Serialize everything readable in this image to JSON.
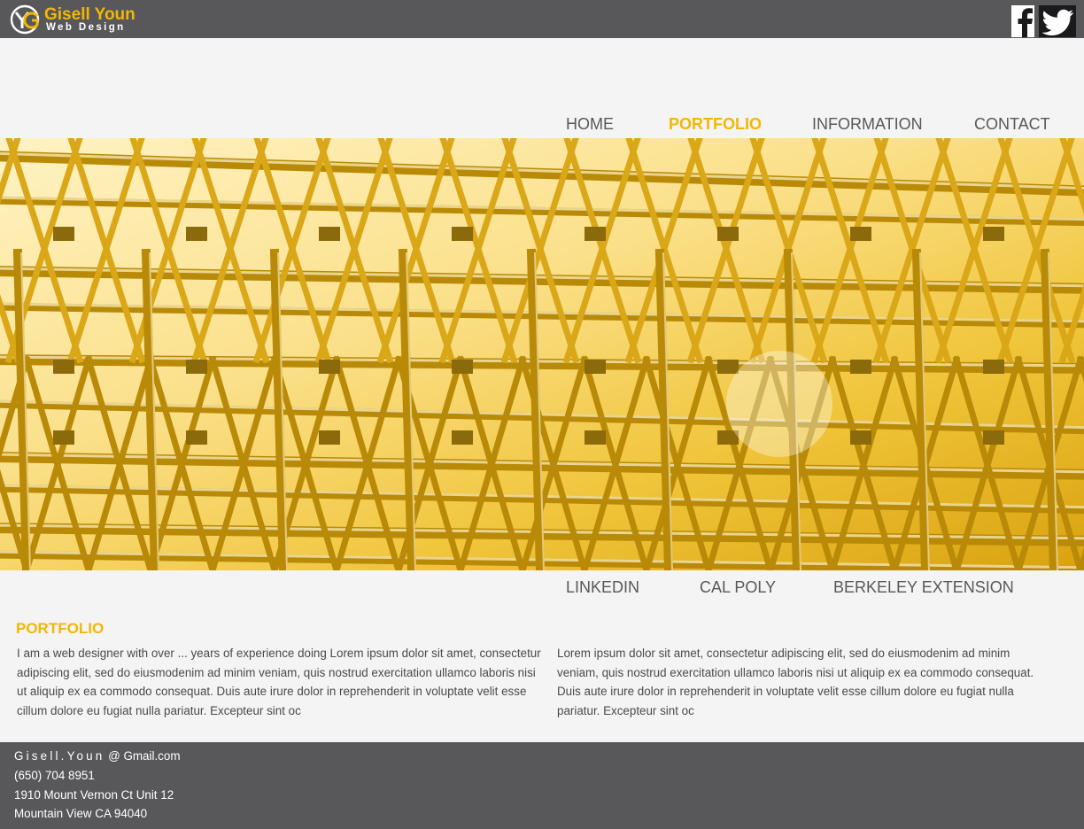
{
  "brand": {
    "name": "Gisell Youn",
    "tagline": "Web Design",
    "monogram": "YG",
    "accent_color": "#f2b705",
    "bar_color": "#58585a"
  },
  "social": {
    "facebook_icon": "facebook-icon",
    "twitter_icon": "twitter-icon"
  },
  "nav": {
    "items": [
      {
        "label": "HOME"
      },
      {
        "label": "PORTFOLIO"
      },
      {
        "label": "INFORMATION"
      },
      {
        "label": "CONTACT"
      }
    ],
    "active": "PORTFOLIO"
  },
  "hero": {
    "image": "golden steel roof trusses photo"
  },
  "subnav": {
    "items": [
      {
        "label": "LINKEDIN"
      },
      {
        "label": "CAL POLY"
      },
      {
        "label": "BERKELEY EXTENSION"
      }
    ]
  },
  "content": {
    "title": "PORTFOLIO",
    "column1": "I am a web designer with over ... years of experience  doing Lorem ipsum dolor sit amet, consectetur adipiscing elit, sed do eiusmodenim ad minim veniam, quis nostrud exercitation ullamco laboris nisi ut aliquip ex ea commodo consequat. Duis aute irure dolor in reprehenderit in voluptate velit esse cillum dolore eu fugiat nulla pariatur. Excepteur sint oc",
    "column2": "Lorem ipsum dolor sit amet, consectetur adipiscing elit, sed do eiusmodenim ad minim veniam, quis nostrud exercitation ullamco laboris nisi ut aliquip ex ea commodo consequat. Duis aute irure dolor in reprehenderit in voluptate velit esse cillum dolore eu fugiat nulla pariatur. Excepteur sint oc"
  },
  "footer": {
    "email_user": "Gisell.Youn",
    "email_domain": " @ Gmail.com",
    "phone": "(650) 704 8951",
    "address_line1": "1910 Mount Vernon Ct Unit 12",
    "address_line2": "Mountain View CA 94040"
  }
}
